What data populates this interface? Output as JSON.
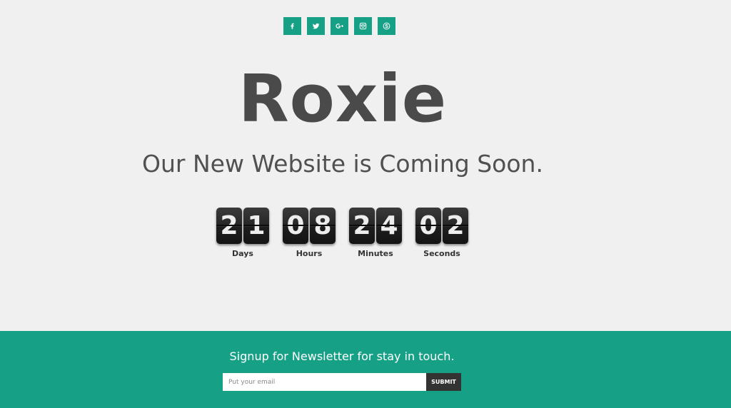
{
  "social": [
    {
      "name": "facebook",
      "icon": "facebook-icon"
    },
    {
      "name": "twitter",
      "icon": "twitter-icon"
    },
    {
      "name": "google-plus",
      "icon": "google-plus-icon"
    },
    {
      "name": "instagram",
      "icon": "instagram-icon"
    },
    {
      "name": "skype",
      "icon": "skype-icon"
    }
  ],
  "brand": {
    "name": "Roxie"
  },
  "tagline": "Our New Website is Coming Soon.",
  "countdown": {
    "days": {
      "digits": [
        "2",
        "1"
      ],
      "label": "Days"
    },
    "hours": {
      "digits": [
        "0",
        "8"
      ],
      "label": "Hours"
    },
    "minutes": {
      "digits": [
        "2",
        "4"
      ],
      "label": "Minutes"
    },
    "seconds": {
      "digits": [
        "0",
        "2"
      ],
      "label": "Seconds"
    }
  },
  "newsletter": {
    "heading": "Signup for Newsletter for stay in touch.",
    "placeholder": "Put your email",
    "submit_label": "SUBMIT"
  },
  "colors": {
    "accent": "#16a085",
    "background": "#f0f0f0",
    "heading": "#4a4a4a",
    "button": "#333333"
  }
}
